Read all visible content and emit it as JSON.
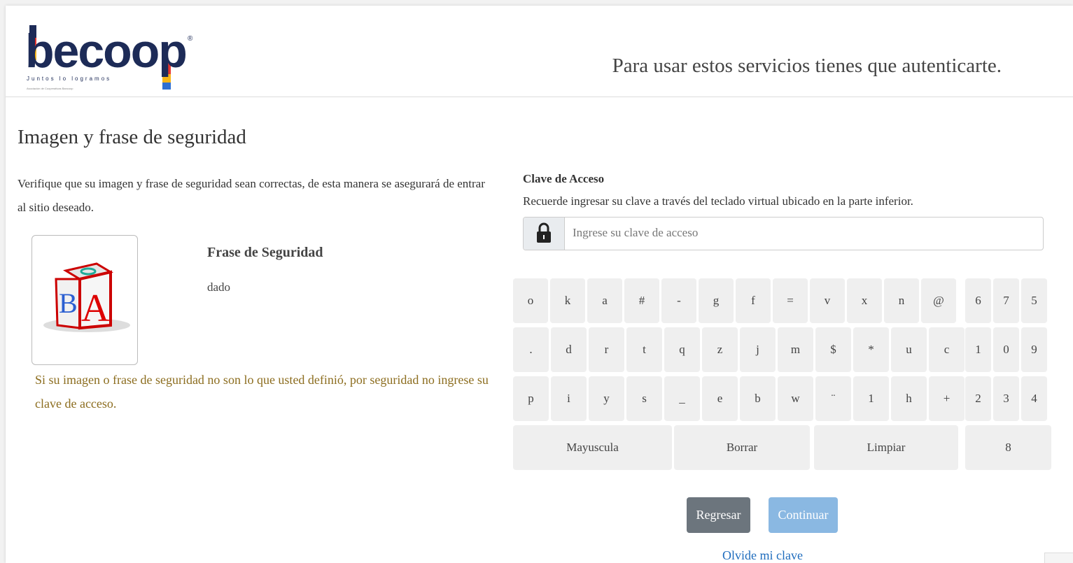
{
  "header": {
    "logo": {
      "word": "becoop",
      "registered": "®",
      "tagline": "Juntos lo logramos",
      "tiny": "Asociación de Cooperativas Bancoop"
    },
    "message": "Para usar estos servicios tienes que autenticarte."
  },
  "left": {
    "title": "Imagen y frase de seguridad",
    "verify_text": "Verifique que su imagen y frase de seguridad sean correctas, de esta manera se asegurará de entrar al sitio deseado.",
    "phrase_title": "Frase de Seguridad",
    "phrase_value": "dado",
    "warning": "Si su imagen o frase de seguridad no son lo que usted definió, por seguridad no ingrese su clave de acceso."
  },
  "right": {
    "title": "Clave de Acceso",
    "instructions": "Recuerde ingresar su clave a través del teclado virtual ubicado en la parte inferior.",
    "password_placeholder": "Ingrese su clave de acceso",
    "password_value": ""
  },
  "keyboard": {
    "rows": [
      [
        "o",
        "k",
        "a",
        "#",
        "-",
        "g",
        "f",
        "=",
        "v",
        "x",
        "n",
        "@"
      ],
      [
        ".",
        "d",
        "r",
        "t",
        "q",
        "z",
        "j",
        "m",
        "$",
        "*",
        "u",
        "c"
      ],
      [
        "p",
        "i",
        "y",
        "s",
        "_",
        "e",
        "b",
        "w",
        "¨",
        "1",
        "h",
        "+"
      ]
    ],
    "numpad": [
      [
        "6",
        "7",
        "5"
      ],
      [
        "1",
        "0",
        "9"
      ],
      [
        "2",
        "3",
        "4"
      ]
    ],
    "bottom": {
      "mayuscula": "Mayuscula",
      "borrar": "Borrar",
      "limpiar": "Limpiar",
      "digit": "8"
    }
  },
  "buttons": {
    "back": "Regresar",
    "continue": "Continuar"
  },
  "forgot": "Olvide mi clave",
  "colors": {
    "brand_navy": "#1d2b57",
    "warning": "#8c6d1f",
    "link": "#1e6cbd",
    "continue_bg": "#8ab8e2",
    "back_bg": "#6c757d",
    "key_bg": "#efefef"
  }
}
